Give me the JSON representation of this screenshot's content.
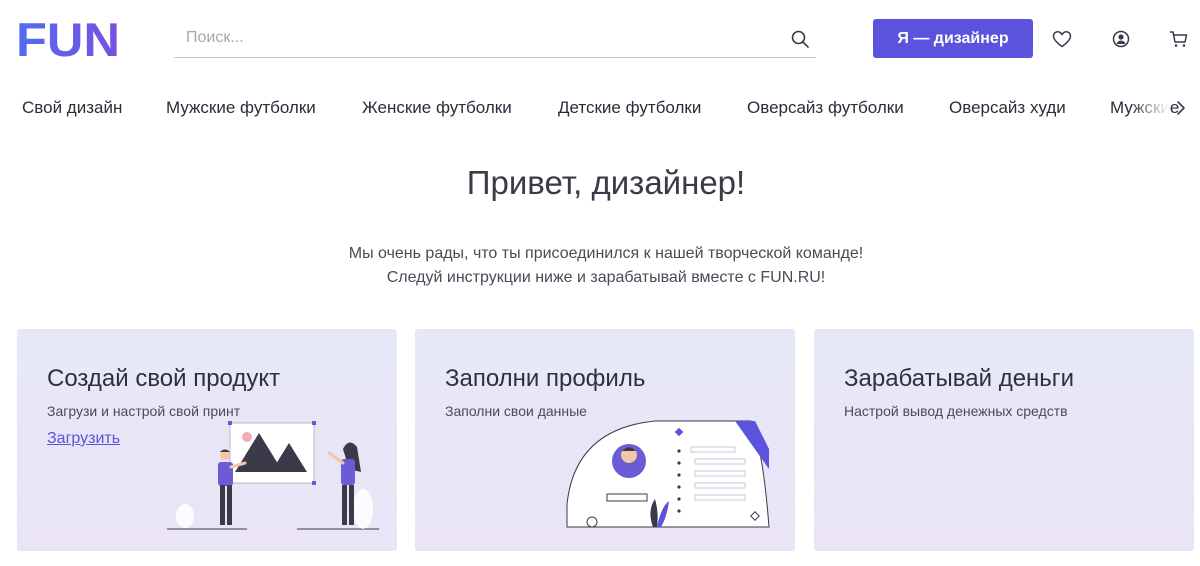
{
  "header": {
    "logo": "FUN",
    "search_placeholder": "Поиск...",
    "designer_button": "Я — дизайнер",
    "icons": [
      "search-icon",
      "heart-icon",
      "user-icon",
      "cart-icon"
    ]
  },
  "nav": {
    "items": [
      {
        "label": "Свой дизайн"
      },
      {
        "label": "Мужские футболки"
      },
      {
        "label": "Женские футболки"
      },
      {
        "label": "Детские футболки"
      },
      {
        "label": "Оверсайз футболки"
      },
      {
        "label": "Оверсайз худи"
      },
      {
        "label": "Мужские"
      }
    ]
  },
  "hero": {
    "title": "Привет, дизайнер!",
    "line1": "Мы очень рады, что ты присоединился к нашей творческой команде!",
    "line2": "Следуй инструкции ниже и зарабатывай вместе с FUN.RU!"
  },
  "cards": [
    {
      "title": "Создай свой продукт",
      "desc": "Загрузи и настрой свой принт",
      "link": "Загрузить"
    },
    {
      "title": "Заполни профиль",
      "desc": "Заполни свои данные"
    },
    {
      "title": "Зарабатывай деньги",
      "desc": "Настрой вывод денежных средств"
    }
  ],
  "colors": {
    "accent": "#5b52de",
    "logo_gradient_start": "#4f6ef0",
    "logo_gradient_end": "#7b4fe0",
    "card_bg": "#e6e8f8"
  }
}
